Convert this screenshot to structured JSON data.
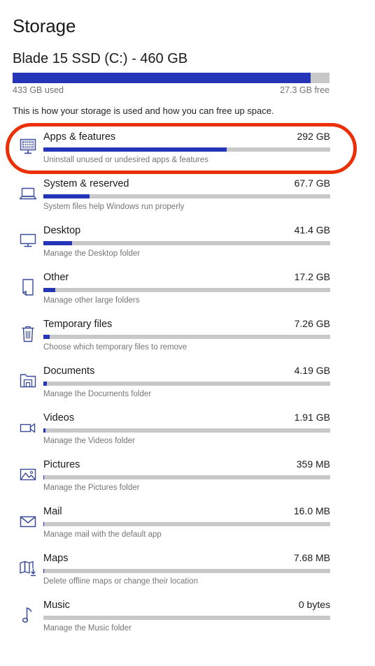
{
  "header": {
    "page_title": "Storage",
    "drive_title": "Blade 15 SSD (C:) - 460 GB",
    "used_label": "433 GB used",
    "free_label": "27.3 GB free",
    "intro_text": "This is how your storage is used and how you can free up space.",
    "drive_used_percent": 94
  },
  "colors": {
    "accent_blue": "#2436b7",
    "track_gray": "#c8c8c8",
    "icon_blue": "#3a4a9b",
    "annotation_red": "#eb2f06",
    "text_primary": "#1a1a1a",
    "text_secondary": "#767676"
  },
  "annotation": {
    "shape": "oval",
    "target": "Apps & features",
    "color": "#eb2f06"
  },
  "categories": [
    {
      "icon": "apps-monitor-icon",
      "name": "Apps & features",
      "size": "292 GB",
      "description": "Uninstall unused or undesired apps & features",
      "bar_percent": 64,
      "highlighted": true
    },
    {
      "icon": "laptop-icon",
      "name": "System & reserved",
      "size": "67.7 GB",
      "description": "System files help Windows run properly",
      "bar_percent": 16,
      "highlighted": false
    },
    {
      "icon": "monitor-icon",
      "name": "Desktop",
      "size": "41.4 GB",
      "description": "Manage the Desktop folder",
      "bar_percent": 10,
      "highlighted": false
    },
    {
      "icon": "page-fold-icon",
      "name": "Other",
      "size": "17.2 GB",
      "description": "Manage other large folders",
      "bar_percent": 4.2,
      "highlighted": false
    },
    {
      "icon": "trash-icon",
      "name": "Temporary files",
      "size": "7.26 GB",
      "description": "Choose which temporary files to remove",
      "bar_percent": 2.2,
      "highlighted": false
    },
    {
      "icon": "documents-folder-icon",
      "name": "Documents",
      "size": "4.19 GB",
      "description": "Manage the Documents folder",
      "bar_percent": 1.3,
      "highlighted": false
    },
    {
      "icon": "video-camera-icon",
      "name": "Videos",
      "size": "1.91 GB",
      "description": "Manage the Videos folder",
      "bar_percent": 0.8,
      "highlighted": false
    },
    {
      "icon": "picture-icon",
      "name": "Pictures",
      "size": "359 MB",
      "description": "Manage the Pictures folder",
      "bar_percent": 0.3,
      "highlighted": false
    },
    {
      "icon": "envelope-icon",
      "name": "Mail",
      "size": "16.0 MB",
      "description": "Manage mail with the default app",
      "bar_percent": 0.15,
      "highlighted": false
    },
    {
      "icon": "map-download-icon",
      "name": "Maps",
      "size": "7.68 MB",
      "description": "Delete offline maps or change their location",
      "bar_percent": 0.12,
      "highlighted": false
    },
    {
      "icon": "music-note-icon",
      "name": "Music",
      "size": "0 bytes",
      "description": "Manage the Music folder",
      "bar_percent": 0,
      "highlighted": false
    }
  ]
}
